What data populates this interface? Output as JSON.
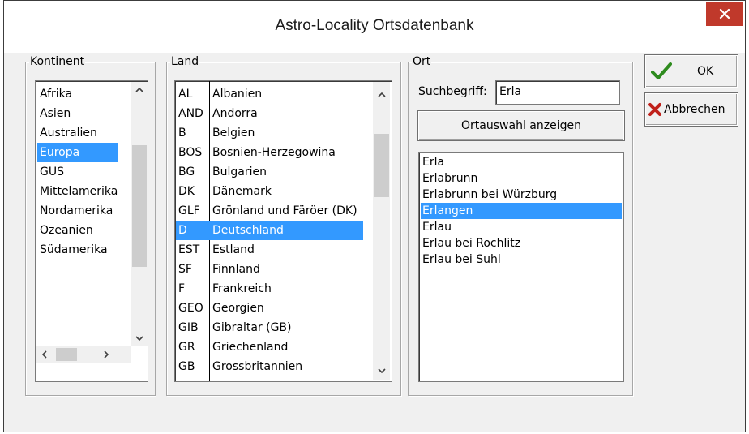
{
  "window": {
    "title": "Astro-Locality Ortsdatenbank"
  },
  "kontinent": {
    "legend": "Kontinent",
    "items": [
      "Afrika",
      "Asien",
      "Australien",
      "Europa",
      "GUS",
      "Mittelamerika",
      "Nordamerika",
      "Ozeanien",
      "Südamerika"
    ],
    "selected": "Europa"
  },
  "land": {
    "legend": "Land",
    "rows": [
      {
        "code": "AL",
        "name": "Albanien"
      },
      {
        "code": "AND",
        "name": "Andorra"
      },
      {
        "code": "B",
        "name": "Belgien"
      },
      {
        "code": "BOS",
        "name": "Bosnien-Herzegowina"
      },
      {
        "code": "BG",
        "name": "Bulgarien"
      },
      {
        "code": "DK",
        "name": "Dänemark"
      },
      {
        "code": "GLF",
        "name": "Grönland und Färöer (DK)"
      },
      {
        "code": "D",
        "name": "Deutschland"
      },
      {
        "code": "EST",
        "name": "Estland"
      },
      {
        "code": "SF",
        "name": "Finnland"
      },
      {
        "code": "F",
        "name": "Frankreich"
      },
      {
        "code": "GEO",
        "name": "Georgien"
      },
      {
        "code": "GIB",
        "name": "Gibraltar (GB)"
      },
      {
        "code": "GR",
        "name": "Griechenland"
      },
      {
        "code": "GB",
        "name": "Grossbritannien"
      }
    ],
    "selected": "Deutschland"
  },
  "ort": {
    "legend": "Ort",
    "search_label": "Suchbegriff:",
    "search_value": "Erla",
    "show_button": "Ortauswahl anzeigen",
    "items": [
      "Erla",
      "Erlabrunn",
      "Erlabrunn bei Würzburg",
      "Erlangen",
      "Erlau",
      "Erlau bei Rochlitz",
      "Erlau bei Suhl"
    ],
    "selected": "Erlangen"
  },
  "buttons": {
    "ok": "OK",
    "cancel": "Abbrechen"
  },
  "colors": {
    "selection": "#3399ff",
    "close": "#c0392b",
    "ok_check": "#2e8b1e",
    "cancel_x": "#c0201a"
  },
  "icons": {
    "close": "close-icon",
    "ok": "checkmark-icon",
    "cancel": "red-x-icon"
  }
}
